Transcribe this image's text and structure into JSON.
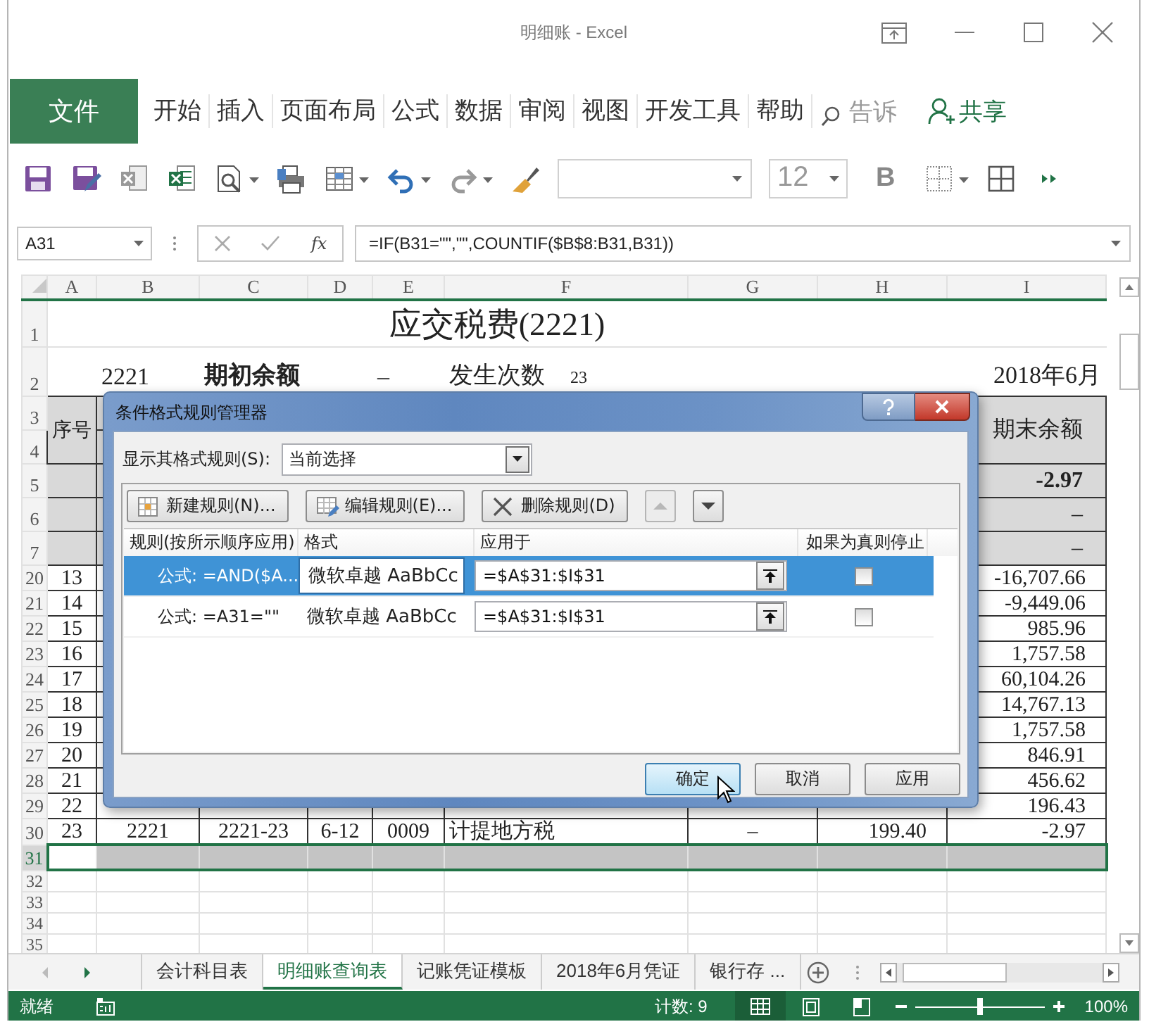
{
  "window": {
    "title": "明细账 - Excel"
  },
  "ribbon_tabs": [
    {
      "label": "文件",
      "kind": "file"
    },
    {
      "label": "开始",
      "kind": "tab"
    },
    {
      "label": "插入",
      "kind": "tab"
    },
    {
      "label": "页面布局",
      "kind": "tab"
    },
    {
      "label": "公式",
      "kind": "tab"
    },
    {
      "label": "数据",
      "kind": "tab"
    },
    {
      "label": "审阅",
      "kind": "tab"
    },
    {
      "label": "视图",
      "kind": "tab"
    },
    {
      "label": "开发工具",
      "kind": "tab"
    },
    {
      "label": "帮助",
      "kind": "tab"
    }
  ],
  "tell_me": "告诉",
  "share": "共享",
  "toolbar": {
    "font_size": "12",
    "bold_label": "B"
  },
  "formula_bar": {
    "name_box": "A31",
    "fx_label": "fx",
    "formula": "=IF(B31=\"\",\"\",COUNTIF($B$8:B31,B31))"
  },
  "columns": [
    "A",
    "B",
    "C",
    "D",
    "E",
    "F",
    "G",
    "H",
    "I"
  ],
  "rows": [
    {
      "number": "1",
      "kind": "title",
      "title": "应交税费(2221)"
    },
    {
      "number": "2",
      "kind": "info",
      "b": "2221",
      "c": "期初余额",
      "e": "–",
      "f": "发生次数",
      "count": "23",
      "i": "2018年6月"
    },
    {
      "number": "3",
      "kind": "header",
      "merged": true,
      "a": "序号",
      "i": "期末余额"
    },
    {
      "number": "4",
      "kind": "header"
    },
    {
      "number": "5",
      "kind": "header",
      "i": "-2.97",
      "bold": true
    },
    {
      "number": "6",
      "kind": "header",
      "i": "–"
    },
    {
      "number": "7",
      "kind": "header",
      "i": "–"
    },
    {
      "number": "20",
      "kind": "data",
      "a": "13",
      "i": "-16,707.66"
    },
    {
      "number": "21",
      "kind": "data",
      "a": "14",
      "i": "-9,449.06"
    },
    {
      "number": "22",
      "kind": "data",
      "a": "15",
      "i": "985.96"
    },
    {
      "number": "23",
      "kind": "data",
      "a": "16",
      "i": "1,757.58"
    },
    {
      "number": "24",
      "kind": "data",
      "a": "17",
      "i": "60,104.26"
    },
    {
      "number": "25",
      "kind": "data",
      "a": "18",
      "i": "14,767.13"
    },
    {
      "number": "26",
      "kind": "data",
      "a": "19",
      "i": "1,757.58"
    },
    {
      "number": "27",
      "kind": "data",
      "a": "20",
      "i": "846.91"
    },
    {
      "number": "28",
      "kind": "data",
      "a": "21",
      "i": "456.62"
    },
    {
      "number": "29",
      "kind": "data",
      "a": "22",
      "i": "196.43"
    },
    {
      "number": "30",
      "kind": "data",
      "a": "23",
      "b": "2221",
      "c": "2221-23",
      "d": "6-12",
      "e": "0009",
      "f": "计提地方税",
      "g": "–",
      "h": "199.40",
      "i": "-2.97"
    },
    {
      "number": "31",
      "kind": "selected"
    },
    {
      "number": "32",
      "kind": "empty"
    },
    {
      "number": "33",
      "kind": "empty"
    },
    {
      "number": "34",
      "kind": "empty"
    },
    {
      "number": "35",
      "kind": "empty"
    }
  ],
  "dialog": {
    "title": "条件格式规则管理器",
    "show_label": "显示其格式规则(S):",
    "show_value": "当前选择",
    "actions": [
      {
        "label": "新建规则(N)...",
        "kind": "new"
      },
      {
        "label": "编辑规则(E)...",
        "kind": "edit"
      },
      {
        "label": "删除规则(D)",
        "kind": "delete"
      }
    ],
    "move_buttons": [
      {
        "kind": "up",
        "disabled": true
      },
      {
        "kind": "down",
        "disabled": false
      }
    ],
    "columns": [
      "规则(按所示顺序应用)",
      "格式",
      "应用于",
      "如果为真则停止"
    ],
    "rules": [
      {
        "rule": "公式: =AND($A...",
        "preview": "微软卓越  AaBbCc",
        "applies_to": "=$A$31:$I$31",
        "stop": false,
        "selected": true
      },
      {
        "rule": "公式: =A31=\"\"",
        "preview": "微软卓越  AaBbCc",
        "applies_to": "=$A$31:$I$31",
        "stop": false,
        "selected": false
      }
    ],
    "buttons": [
      {
        "label": "确定",
        "focused": true
      },
      {
        "label": "取消",
        "focused": false
      },
      {
        "label": "应用",
        "focused": false
      }
    ]
  },
  "sheet_tabs": [
    {
      "label": "会计科目表",
      "selected": false
    },
    {
      "label": "明细账查询表",
      "selected": true
    },
    {
      "label": "记账凭证模板",
      "selected": false
    },
    {
      "label": "2018年6月凭证",
      "selected": false
    },
    {
      "label": "银行存 ...",
      "selected": false
    }
  ],
  "status_bar": {
    "ready": "就绪",
    "count": "计数: 9",
    "views": [
      {
        "kind": "normal",
        "selected": true
      },
      {
        "kind": "page-layout",
        "selected": false
      },
      {
        "kind": "page-break",
        "selected": false
      }
    ],
    "zoom": {
      "level": 0.5,
      "label": "100%"
    }
  }
}
